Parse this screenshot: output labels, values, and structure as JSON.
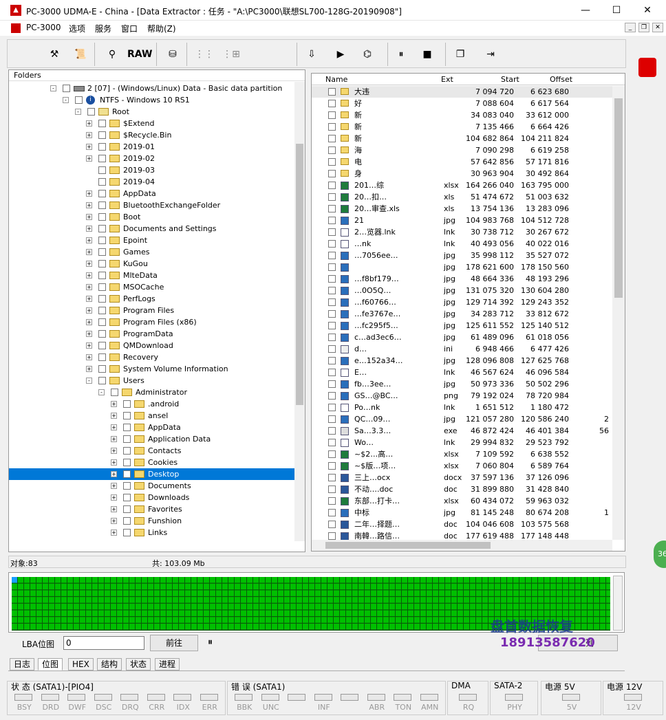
{
  "window": {
    "title": "PC-3000 UDMA-E - China - [Data Extractor : 任务 - \"A:\\PC3000\\联想SL700-128G-20190908\"]",
    "app_icon": "pc3000-icon",
    "minimize": "—",
    "maximize": "☐",
    "close": "✕"
  },
  "menu": {
    "items": [
      "PC-3000",
      "选项",
      "服务",
      "窗口",
      "帮助(Z)"
    ],
    "mdi_min": "_",
    "mdi_restore": "❐",
    "mdi_close": "✕"
  },
  "toolbar": {
    "raw_label": "RAW"
  },
  "folders": {
    "header": "Folders",
    "rows": [
      {
        "label": "2 [07] - (Windows/Linux) Data - Basic data partition",
        "level": 0,
        "exp": "-",
        "icon": "disk"
      },
      {
        "label": "NTFS - Windows 10 RS1",
        "level": 1,
        "exp": "-",
        "icon": "info"
      },
      {
        "label": "Root",
        "level": 2,
        "exp": "-",
        "icon": "root"
      },
      {
        "label": "$Extend",
        "level": 3,
        "exp": "+"
      },
      {
        "label": "$Recycle.Bin",
        "level": 3,
        "exp": "+"
      },
      {
        "label": "2019-01",
        "level": 3,
        "exp": "+"
      },
      {
        "label": "2019-02",
        "level": 3,
        "exp": "+"
      },
      {
        "label": "2019-03",
        "level": 3,
        "exp": ""
      },
      {
        "label": "2019-04",
        "level": 3,
        "exp": ""
      },
      {
        "label": "AppData",
        "level": 3,
        "exp": "+"
      },
      {
        "label": "BluetoothExchangeFolder",
        "level": 3,
        "exp": "+"
      },
      {
        "label": "Boot",
        "level": 3,
        "exp": "+"
      },
      {
        "label": "Documents and Settings",
        "level": 3,
        "exp": "+"
      },
      {
        "label": "Epoint",
        "level": 3,
        "exp": "+"
      },
      {
        "label": "Games",
        "level": 3,
        "exp": "+"
      },
      {
        "label": "KuGou",
        "level": 3,
        "exp": "+"
      },
      {
        "label": "MlteData",
        "level": 3,
        "exp": "+"
      },
      {
        "label": "MSOCache",
        "level": 3,
        "exp": "+"
      },
      {
        "label": "PerfLogs",
        "level": 3,
        "exp": "+"
      },
      {
        "label": "Program Files",
        "level": 3,
        "exp": "+"
      },
      {
        "label": "Program Files (x86)",
        "level": 3,
        "exp": "+"
      },
      {
        "label": "ProgramData",
        "level": 3,
        "exp": "+"
      },
      {
        "label": "QMDownload",
        "level": 3,
        "exp": "+"
      },
      {
        "label": "Recovery",
        "level": 3,
        "exp": "+"
      },
      {
        "label": "System Volume Information",
        "level": 3,
        "exp": "+"
      },
      {
        "label": "Users",
        "level": 3,
        "exp": "-"
      },
      {
        "label": "Administrator",
        "level": 4,
        "exp": "-"
      },
      {
        "label": ".android",
        "level": 5,
        "exp": "+"
      },
      {
        "label": "ansel",
        "level": 5,
        "exp": "+"
      },
      {
        "label": "AppData",
        "level": 5,
        "exp": "+"
      },
      {
        "label": "Application Data",
        "level": 5,
        "exp": "+"
      },
      {
        "label": "Contacts",
        "level": 5,
        "exp": "+"
      },
      {
        "label": "Cookies",
        "level": 5,
        "exp": "+"
      },
      {
        "label": "Desktop",
        "level": 5,
        "exp": "+",
        "selected": true
      },
      {
        "label": "Documents",
        "level": 5,
        "exp": "+"
      },
      {
        "label": "Downloads",
        "level": 5,
        "exp": "+"
      },
      {
        "label": "Favorites",
        "level": 5,
        "exp": "+"
      },
      {
        "label": "Funshion",
        "level": 5,
        "exp": "+"
      },
      {
        "label": "Links",
        "level": 5,
        "exp": "+"
      }
    ]
  },
  "files": {
    "columns": {
      "name": "Name",
      "ext": "Ext",
      "start": "Start",
      "offset": "Offset"
    },
    "rows": [
      {
        "name": "大违",
        "ext": "",
        "start": "7 094 720",
        "offset": "6 623 680",
        "type": "folder"
      },
      {
        "name": "好",
        "ext": "",
        "start": "7 088 604",
        "offset": "6 617 564",
        "type": "folder"
      },
      {
        "name": "新",
        "ext": "",
        "start": "34 083 040",
        "offset": "33 612 000",
        "type": "folder"
      },
      {
        "name": "新",
        "ext": "",
        "start": "7 135 466",
        "offset": "6 664 426",
        "type": "folder"
      },
      {
        "name": "新",
        "ext": "",
        "start": "104 682 864",
        "offset": "104 211 824",
        "type": "folder"
      },
      {
        "name": "海",
        "ext": "",
        "start": "7 090 298",
        "offset": "6 619 258",
        "type": "folder"
      },
      {
        "name": "电",
        "ext": "",
        "start": "57 642 856",
        "offset": "57 171 816",
        "type": "folder"
      },
      {
        "name": "身",
        "ext": "",
        "start": "30 963 904",
        "offset": "30 492 864",
        "type": "folder"
      },
      {
        "name": "201…综",
        "ext": "xlsx",
        "start": "164 266 040",
        "offset": "163 795 000",
        "type": "excel"
      },
      {
        "name": "20…扣…",
        "ext": "xls",
        "start": "51 474 672",
        "offset": "51 003 632",
        "type": "excel"
      },
      {
        "name": "20…审查.xls",
        "ext": "xls",
        "start": "13 754 136",
        "offset": "13 283 096",
        "type": "excel"
      },
      {
        "name": "21",
        "ext": "jpg",
        "start": "104 983 768",
        "offset": "104 512 728",
        "type": "image"
      },
      {
        "name": "2…览器.lnk",
        "ext": "lnk",
        "start": "30 738 712",
        "offset": "30 267 672",
        "type": "link"
      },
      {
        "name": "…nk",
        "ext": "lnk",
        "start": "40 493 056",
        "offset": "40 022 016",
        "type": "link"
      },
      {
        "name": "…7056ee…",
        "ext": "jpg",
        "start": "35 998 112",
        "offset": "35 527 072",
        "type": "image"
      },
      {
        "name": "",
        "ext": "jpg",
        "start": "178 621 600",
        "offset": "178 150 560",
        "type": "image"
      },
      {
        "name": "…f8bf179…",
        "ext": "jpg",
        "start": "48 664 336",
        "offset": "48 193 296",
        "type": "image"
      },
      {
        "name": "…0O5Q…",
        "ext": "jpg",
        "start": "131 075 320",
        "offset": "130 604 280",
        "type": "image"
      },
      {
        "name": "…f60766…",
        "ext": "jpg",
        "start": "129 714 392",
        "offset": "129 243 352",
        "type": "image"
      },
      {
        "name": "…fe3767e…",
        "ext": "jpg",
        "start": "34 283 712",
        "offset": "33 812 672",
        "type": "image"
      },
      {
        "name": "…fc295f5…",
        "ext": "jpg",
        "start": "125 611 552",
        "offset": "125 140 512",
        "type": "image"
      },
      {
        "name": "c…ad3ec6…",
        "ext": "jpg",
        "start": "61 489 096",
        "offset": "61 018 056",
        "type": "image"
      },
      {
        "name": "d…",
        "ext": "ini",
        "start": "6 948 466",
        "offset": "6 477 426",
        "type": "ini"
      },
      {
        "name": "e…152a34…",
        "ext": "jpg",
        "start": "128 096 808",
        "offset": "127 625 768",
        "type": "image"
      },
      {
        "name": "E…",
        "ext": "lnk",
        "start": "46 567 624",
        "offset": "46 096 584",
        "type": "link"
      },
      {
        "name": "fb…3ee…",
        "ext": "jpg",
        "start": "50 973 336",
        "offset": "50 502 296",
        "type": "image"
      },
      {
        "name": "GS…@BC…",
        "ext": "png",
        "start": "79 192 024",
        "offset": "78 720 984",
        "type": "image"
      },
      {
        "name": "Po…nk",
        "ext": "lnk",
        "start": "1 651 512",
        "offset": "1 180 472",
        "type": "link"
      },
      {
        "name": "QC…09…",
        "ext": "jpg",
        "start": "121 057 280",
        "offset": "120 586 240",
        "type": "image",
        "extra": "2"
      },
      {
        "name": "Sa…3.3…",
        "ext": "exe",
        "start": "46 872 424",
        "offset": "46 401 384",
        "type": "exe",
        "extra": "56"
      },
      {
        "name": "Wo…",
        "ext": "lnk",
        "start": "29 994 832",
        "offset": "29 523 792",
        "type": "link"
      },
      {
        "name": "~$2…高…",
        "ext": "xlsx",
        "start": "7 109 592",
        "offset": "6 638 552",
        "type": "excel"
      },
      {
        "name": "~$版…项…",
        "ext": "xlsx",
        "start": "7 060 804",
        "offset": "6 589 764",
        "type": "excel"
      },
      {
        "name": "三上…ocx",
        "ext": "docx",
        "start": "37 597 136",
        "offset": "37 126 096",
        "type": "word"
      },
      {
        "name": "不动….doc",
        "ext": "doc",
        "start": "31 899 880",
        "offset": "31 428 840",
        "type": "word"
      },
      {
        "name": "东部…打卡…",
        "ext": "xlsx",
        "start": "60 434 072",
        "offset": "59 963 032",
        "type": "excel"
      },
      {
        "name": "中标",
        "ext": "jpg",
        "start": "81 145 248",
        "offset": "80 674 208",
        "type": "image",
        "extra": "1"
      },
      {
        "name": "二年…择题…",
        "ext": "doc",
        "start": "104 046 608",
        "offset": "103 575 568",
        "type": "word"
      },
      {
        "name": "南韓…路信…",
        "ext": "doc",
        "start": "177 619 488",
        "offset": "177 148 448",
        "type": "word"
      }
    ]
  },
  "status": {
    "objects": "对象:83",
    "total": "共: 103.09 Mb"
  },
  "lba": {
    "label": "LBA位图",
    "value": "0",
    "go_button": "前往",
    "pause": "⏸",
    "list_button": "列"
  },
  "watermark": {
    "line1": "盘首数据恢复",
    "line2": "18913587620"
  },
  "tabs": [
    "日志",
    "位图",
    "HEX",
    "结构",
    "状态",
    "进程"
  ],
  "statusbar": {
    "groups": [
      {
        "title": "状 态 (SATA1)-[PIO4]",
        "leds": [
          "BSY",
          "DRD",
          "DWF",
          "DSC",
          "DRQ",
          "CRR",
          "IDX",
          "ERR"
        ]
      },
      {
        "title": "错 误 (SATA1)",
        "leds": [
          "BBK",
          "UNC",
          "",
          "INF",
          "",
          "ABR",
          "TON",
          "AMN"
        ]
      },
      {
        "title": "DMA",
        "leds": [
          "RQ"
        ]
      },
      {
        "title": "SATA-2",
        "leds": [
          "PHY"
        ]
      },
      {
        "title": "电源 5V",
        "leds": [
          "5V"
        ]
      },
      {
        "title": "电源 12V",
        "leds": [
          "12V"
        ]
      }
    ]
  },
  "side_badge": "36",
  "colors": {
    "selection": "#0078d7",
    "map_green": "#00c000"
  }
}
